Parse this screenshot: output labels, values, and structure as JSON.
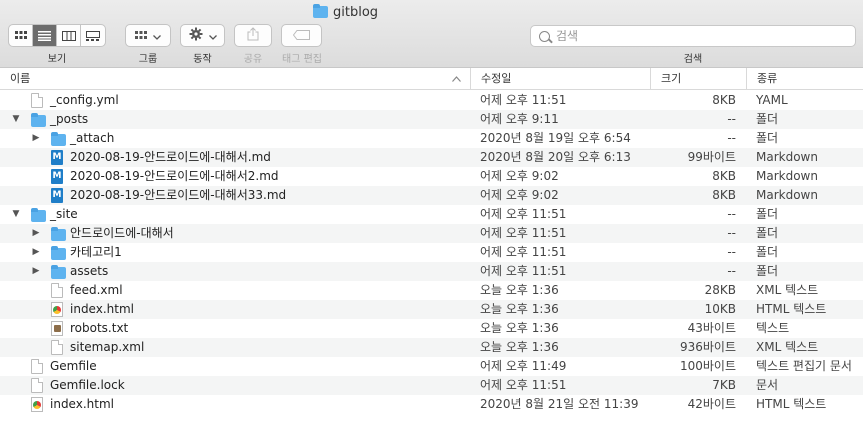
{
  "window": {
    "title": "gitblog"
  },
  "toolbar": {
    "view_label": "보기",
    "group_label": "그룹",
    "action_label": "동작",
    "share_label": "공유",
    "tag_label": "태그 편집",
    "search_label": "검색",
    "search_placeholder": "검색"
  },
  "columns": {
    "name": "이름",
    "date": "수정일",
    "size": "크기",
    "kind": "종류"
  },
  "rows": [
    {
      "name": "_config.yml",
      "date": "어제 오후 11:51",
      "size": "8KB",
      "kind": "YAML",
      "icon": "document-icon"
    },
    {
      "name": "_posts",
      "date": "어제 오후 9:11",
      "size": "--",
      "kind": "폴더",
      "icon": "folder-icon",
      "expanded": true
    },
    {
      "name": "_attach",
      "date": "2020년 8월 19일 오후 6:54",
      "size": "--",
      "kind": "폴더",
      "icon": "folder-icon",
      "expanded": false
    },
    {
      "name": "2020-08-19-안드로이드에-대해서.md",
      "date": "2020년 8월 20일 오후 6:13",
      "size": "99바이트",
      "kind": "Markdown",
      "icon": "markdown-icon"
    },
    {
      "name": "2020-08-19-안드로이드에-대해서2.md",
      "date": "어제 오후 9:02",
      "size": "8KB",
      "kind": "Markdown",
      "icon": "markdown-icon"
    },
    {
      "name": "2020-08-19-안드로이드에-대해서33.md",
      "date": "어제 오후 9:02",
      "size": "8KB",
      "kind": "Markdown",
      "icon": "markdown-icon"
    },
    {
      "name": "_site",
      "date": "어제 오후 11:51",
      "size": "--",
      "kind": "폴더",
      "icon": "folder-icon",
      "expanded": true
    },
    {
      "name": "안드로이드에-대해서",
      "date": "어제 오후 11:51",
      "size": "--",
      "kind": "폴더",
      "icon": "folder-icon",
      "expanded": false
    },
    {
      "name": "카테고리1",
      "date": "어제 오후 11:51",
      "size": "--",
      "kind": "폴더",
      "icon": "folder-icon",
      "expanded": false
    },
    {
      "name": "assets",
      "date": "어제 오후 11:51",
      "size": "--",
      "kind": "폴더",
      "icon": "folder-icon",
      "expanded": false
    },
    {
      "name": "feed.xml",
      "date": "오늘 오후 1:36",
      "size": "28KB",
      "kind": "XML 텍스트",
      "icon": "document-icon"
    },
    {
      "name": "index.html",
      "date": "오늘 오후 1:36",
      "size": "10KB",
      "kind": "HTML 텍스트",
      "icon": "html-icon"
    },
    {
      "name": "robots.txt",
      "date": "오늘 오후 1:36",
      "size": "43바이트",
      "kind": "텍스트",
      "icon": "text-icon"
    },
    {
      "name": "sitemap.xml",
      "date": "오늘 오후 1:36",
      "size": "936바이트",
      "kind": "XML 텍스트",
      "icon": "document-icon"
    },
    {
      "name": "Gemfile",
      "date": "어제 오후 11:49",
      "size": "100바이트",
      "kind": "텍스트 편집기 문서",
      "icon": "document-icon"
    },
    {
      "name": "Gemfile.lock",
      "date": "어제 오후 11:51",
      "size": "7KB",
      "kind": "문서",
      "icon": "document-icon"
    },
    {
      "name": "index.html",
      "date": "2020년 8월 21일 오전 11:39",
      "size": "42바이트",
      "kind": "HTML 텍스트",
      "icon": "html-icon"
    }
  ]
}
